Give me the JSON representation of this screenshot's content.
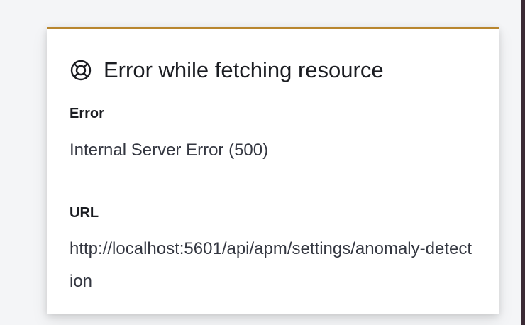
{
  "toast": {
    "icon": "lifebuoy-icon",
    "title": "Error while fetching resource",
    "accent_color": "#b8862f",
    "error_label": "Error",
    "error_value": "Internal Server Error (500)",
    "url_label": "URL",
    "url_value": "http://localhost:5601/api/apm/settings/anomaly-detection"
  }
}
